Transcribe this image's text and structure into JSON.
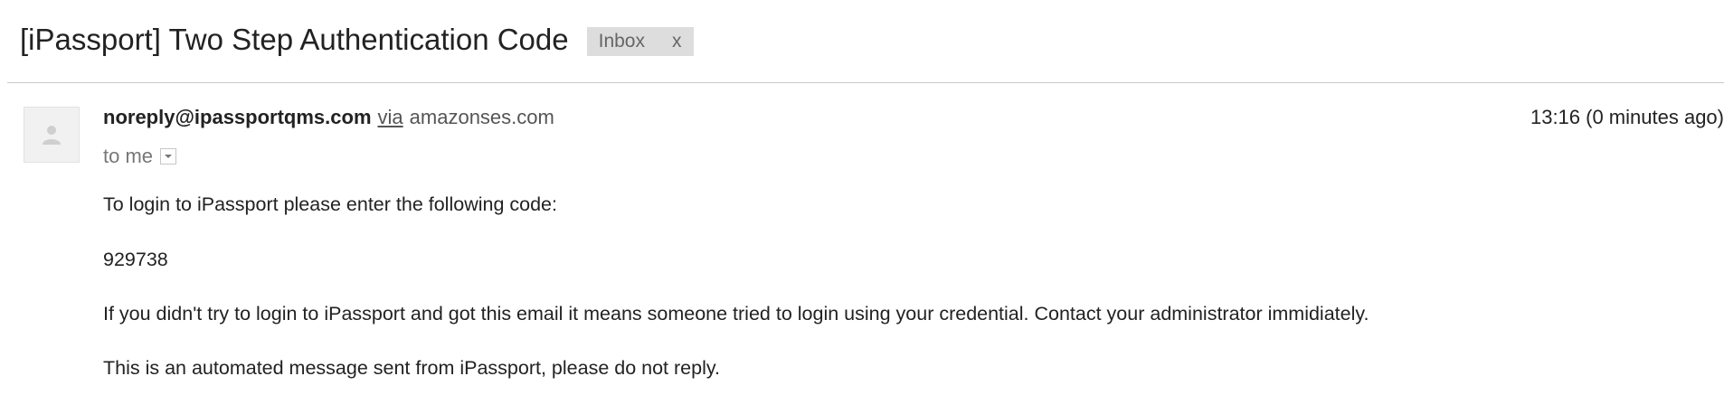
{
  "email": {
    "subject": "[iPassport] Two Step Authentication Code",
    "label": {
      "text": "Inbox",
      "close": "x"
    },
    "sender": {
      "email": "noreply@ipassportqms.com",
      "via_text": "via",
      "via_domain": "amazonses.com",
      "avatar_icon": "person-icon"
    },
    "recipient_text": "to me",
    "details_icon": "dropdown-arrow-icon",
    "time": "13:16 (0 minutes ago)",
    "body": {
      "line1": "To login to iPassport please enter the following code:",
      "code": "929738",
      "line3": "If you didn't try to login to iPassport and got this email it means someone tried to login using your credential. Contact your administrator immidiately.",
      "line4": "This is an automated message sent from iPassport, please do not reply."
    }
  },
  "colors": {
    "chip_bg": "#dddddd",
    "divider": "#c9c9c9",
    "muted_text": "#777777",
    "text": "#222222"
  }
}
